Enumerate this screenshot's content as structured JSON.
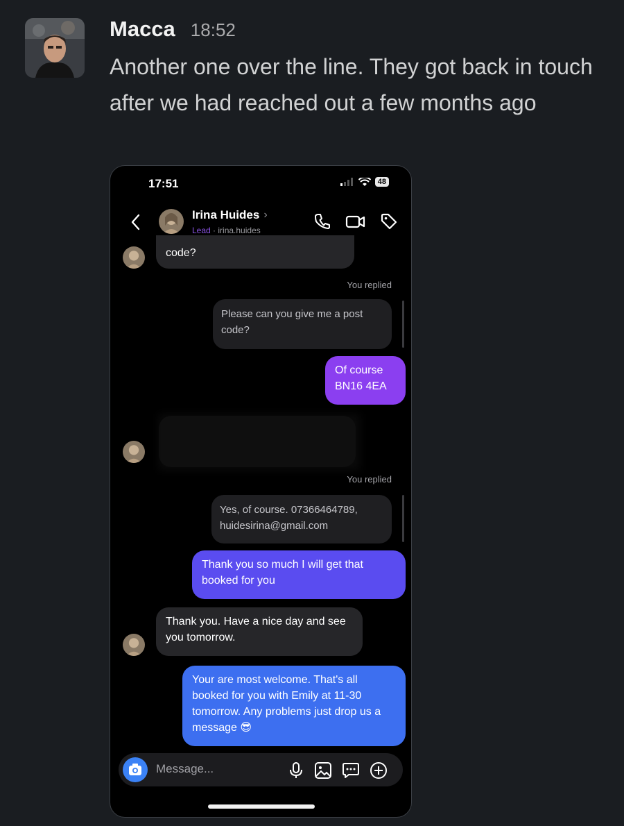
{
  "slack": {
    "sender": "Macca",
    "time": "18:52",
    "text": "Another one over the line. They got back in touch after we had reached out a few months ago"
  },
  "phone": {
    "status_time": "17:51",
    "battery": "48",
    "contact_name": "Irina Huides",
    "contact_label": "Lead",
    "contact_handle": "· irina.huides",
    "messages": {
      "m1_in": "code?",
      "m2_replied_label": "You replied",
      "m2_quote": "Please can you give me a post code?",
      "m3_out": "Of course BN16 4EA",
      "m5_replied_label": "You replied",
      "m5_quote": "Yes, of course. 07366464789, huidesirina@gmail.com",
      "m6_out": "Thank you so much I will get that booked for you",
      "m7_in": "Thank you. Have a nice day and see you tomorrow.",
      "m8_out": "Your are most welcome. That's all booked for you with Emily at 11-30 tomorrow. Any problems just drop us a message 😎"
    },
    "composer_placeholder": "Message..."
  },
  "colors": {
    "bg": "#1a1d21",
    "out_purple": "#8b3ff0",
    "out_indigo": "#5a4cf0",
    "out_blue": "#3d6ff0",
    "in_bubble": "#262629"
  },
  "icons": [
    "chevron-left-icon",
    "phone-icon",
    "video-icon",
    "tag-icon",
    "camera-icon",
    "mic-icon",
    "gallery-icon",
    "sticker-icon",
    "plus-icon",
    "wifi-icon",
    "signal-icon"
  ]
}
